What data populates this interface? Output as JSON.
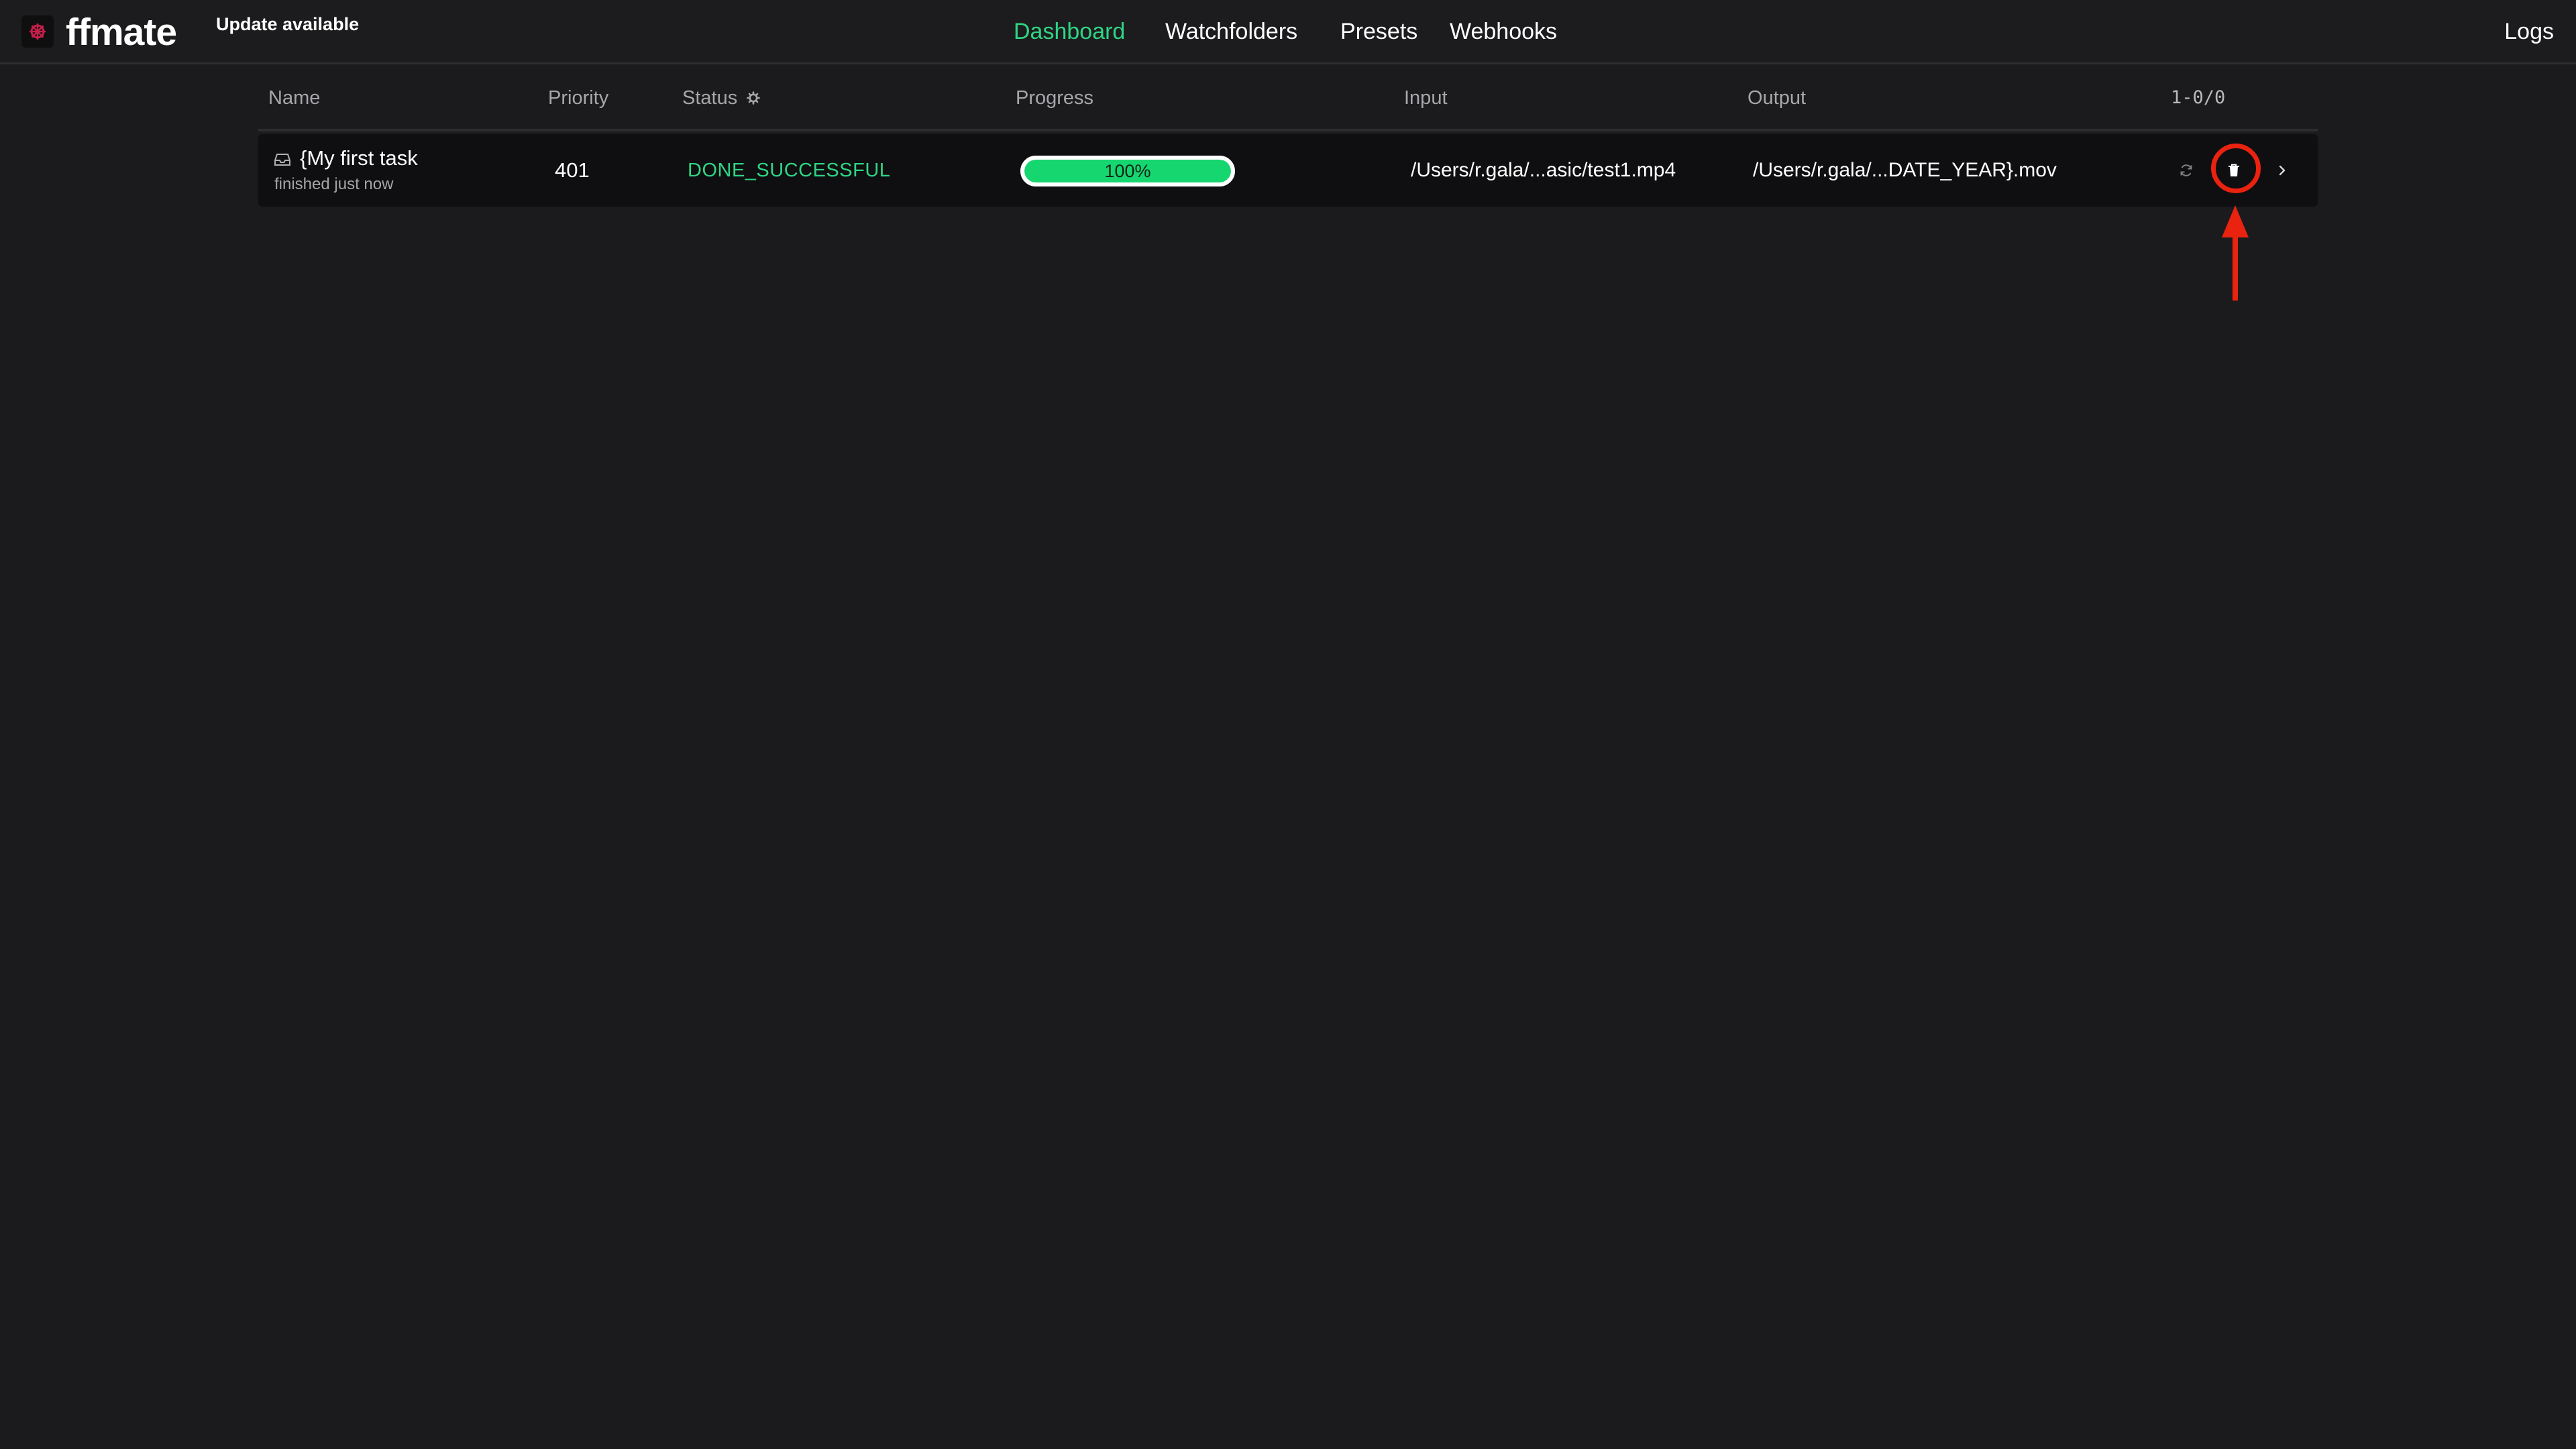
{
  "app": {
    "name": "ffmate",
    "update_note": "Update available"
  },
  "nav": {
    "items": [
      {
        "label": "Dashboard",
        "active": true
      },
      {
        "label": "Watchfolders",
        "active": false
      },
      {
        "label": "Presets",
        "active": false
      },
      {
        "label": "Webhooks",
        "active": false
      }
    ],
    "right_link": "Logs"
  },
  "colors": {
    "accent": "#2fd584",
    "progress_fill": "#16d66f",
    "annotation": "#ea2210",
    "background": "#1b1b1d"
  },
  "table": {
    "columns": [
      "Name",
      "Priority",
      "Status",
      "Progress",
      "Input",
      "Output"
    ],
    "pager": "1-0/0",
    "status_filter_icon": "gear-icon",
    "rows": [
      {
        "name": "{My first task",
        "subtext": "finished just now",
        "priority": "401",
        "status": "DONE_SUCCESSFUL",
        "progress_value": 1.0,
        "progress_label": "100%",
        "input": "/Users/r.gala/...asic/test1.mp4",
        "output": "/Users/r.gala/...DATE_YEAR}.mov",
        "actions": [
          "retry-icon",
          "trash-icon",
          "chevron-right-icon"
        ]
      }
    ]
  }
}
